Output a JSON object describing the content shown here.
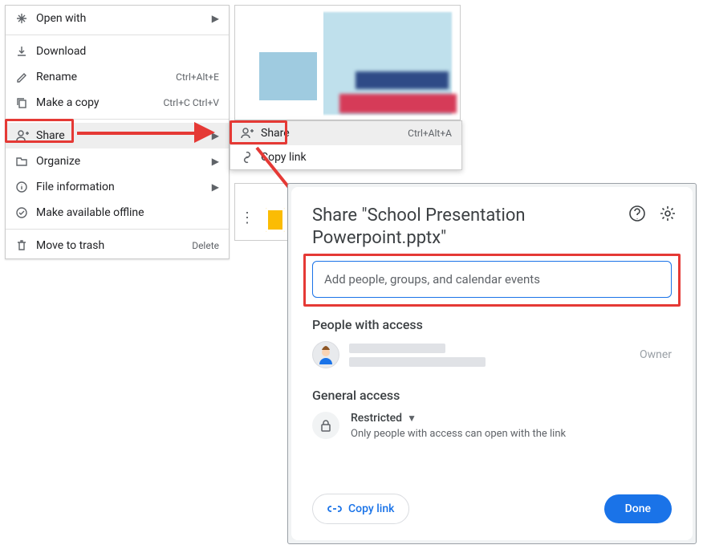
{
  "context_menu": {
    "open_with": "Open with",
    "download": "Download",
    "rename": "Rename",
    "rename_shortcut": "Ctrl+Alt+E",
    "make_copy": "Make a copy",
    "make_copy_shortcut": "Ctrl+C Ctrl+V",
    "share": "Share",
    "organize": "Organize",
    "file_info": "File information",
    "offline": "Make available offline",
    "trash": "Move to trash",
    "trash_shortcut": "Delete"
  },
  "submenu": {
    "share": "Share",
    "share_shortcut": "Ctrl+Alt+A",
    "copy_link": "Copy link"
  },
  "dialog": {
    "title": "Share \"School Presentation Powerpoint.pptx\"",
    "input_placeholder": "Add people, groups, and calendar events",
    "people_heading": "People with access",
    "owner_role": "Owner",
    "general_heading": "General access",
    "access_level": "Restricted",
    "access_help": "Only people with access can open with the link",
    "copy_link": "Copy link",
    "done": "Done"
  }
}
